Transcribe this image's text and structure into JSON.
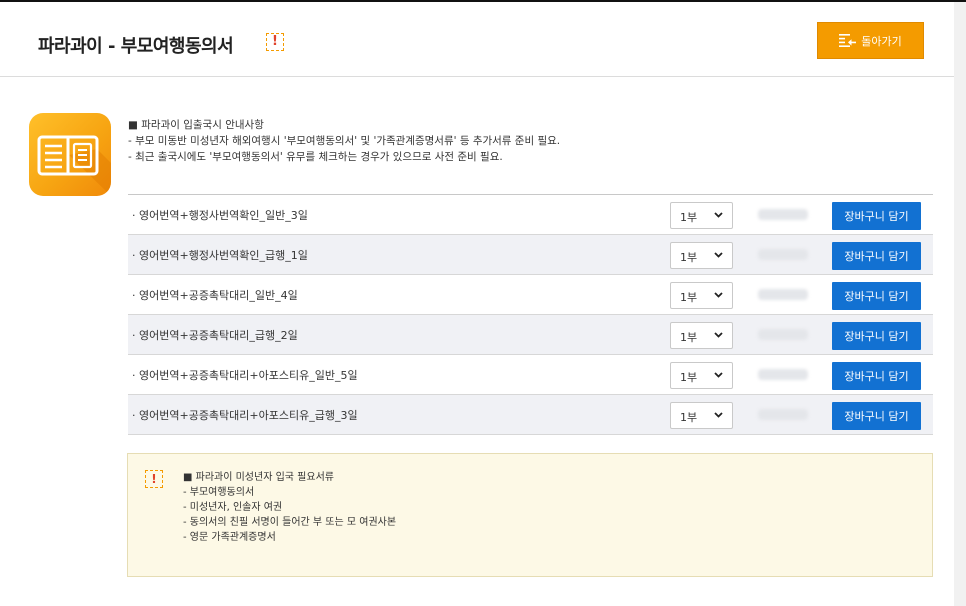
{
  "header": {
    "title": "파라과이 - 부모여행동의서",
    "alert_glyph": "!",
    "back_button": "돌아가기"
  },
  "notice": {
    "lines": [
      "■ 파라과이 입출국시 안내사항",
      "- 부모 미동반 미성년자 해외여행시 '부모여행동의서' 및 '가족관계증명서류' 등 추가서류 준비 필요.",
      "- 최근 출국시에도 '부모여행동의서' 유무를 체크하는 경우가 있으므로 사전 준비 필요."
    ]
  },
  "products": [
    {
      "name": "영어번역+행정사번역확인_일반_3일",
      "qty": "1부",
      "cart": "장바구니 담기"
    },
    {
      "name": "영어번역+행정사번역확인_급행_1일",
      "qty": "1부",
      "cart": "장바구니 담기"
    },
    {
      "name": "영어번역+공증촉탁대리_일반_4일",
      "qty": "1부",
      "cart": "장바구니 담기"
    },
    {
      "name": "영어번역+공증촉탁대리_급행_2일",
      "qty": "1부",
      "cart": "장바구니 담기"
    },
    {
      "name": "영어번역+공증촉탁대리+아포스티유_일반_5일",
      "qty": "1부",
      "cart": "장바구니 담기"
    },
    {
      "name": "영어번역+공증촉탁대리+아포스티유_급행_3일",
      "qty": "1부",
      "cart": "장바구니 담기"
    }
  ],
  "requirements": {
    "alert_glyph": "!",
    "lines": [
      "■ 파라과이 미성년자 입국 필요서류",
      "- 부모여행동의서",
      "- 미성년자, 인솔자 여권",
      "- 동의서의 친필 서명이 들어간 부 또는 모 여권사본",
      "- 영문 가족관계증명서"
    ]
  },
  "colors": {
    "accent_orange": "#f49b00",
    "cart_blue": "#1271d2",
    "alert_red": "#e0422b",
    "req_box_bg": "#fdf9e6"
  },
  "icons": {
    "book": "open-book-document-icon",
    "back": "list-back-arrow-icon",
    "chevron": "chevron-down-icon"
  }
}
